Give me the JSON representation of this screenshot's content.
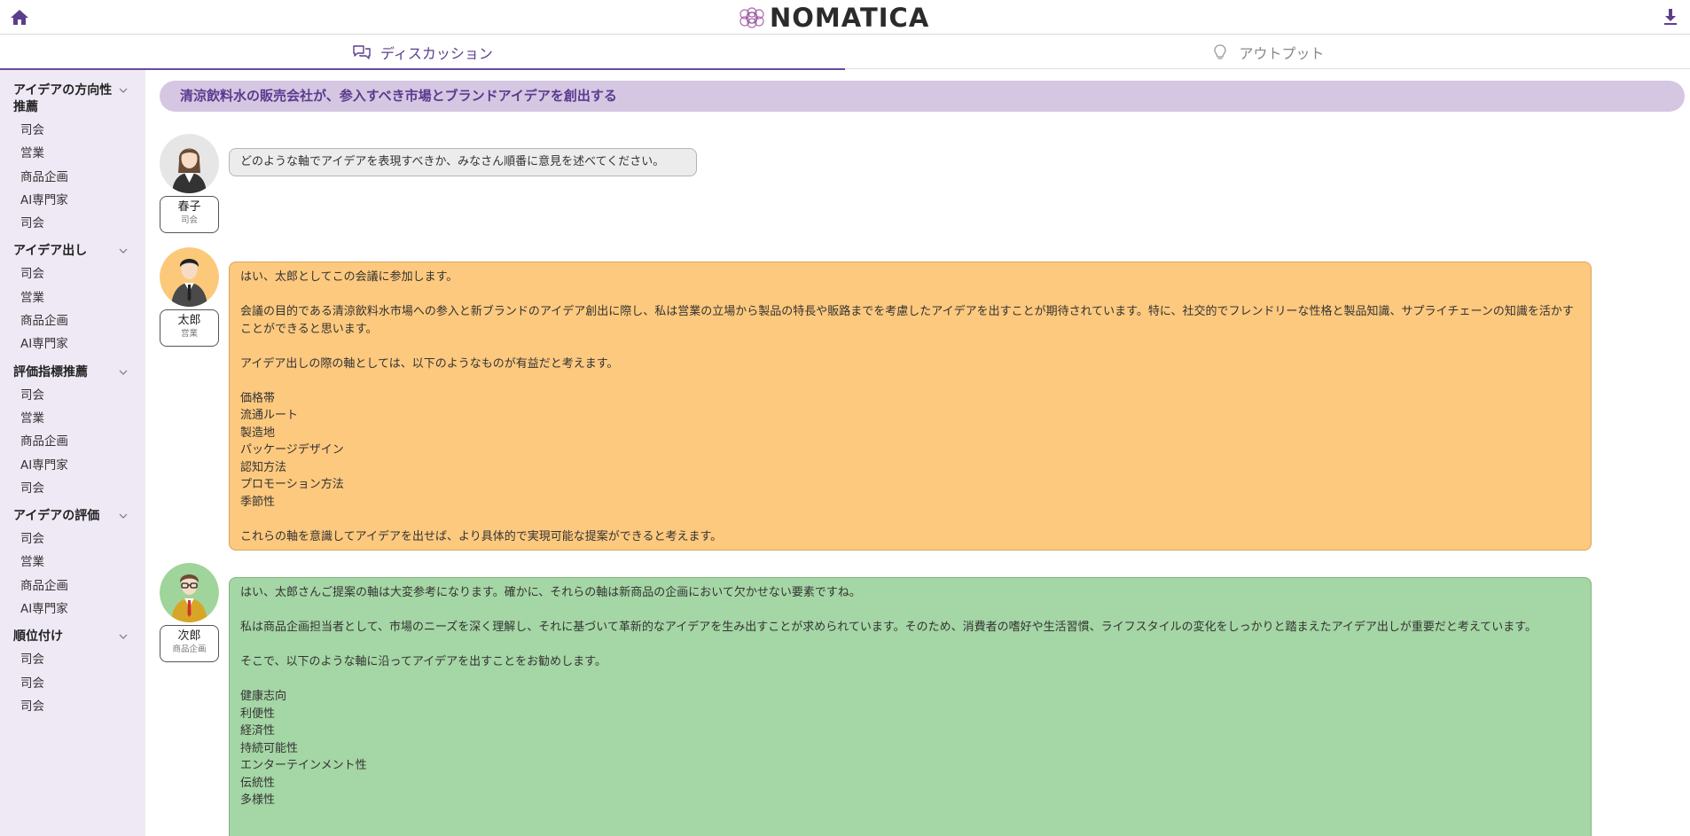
{
  "header": {
    "logo_text": "NOMATICA",
    "home_icon": "home-icon",
    "download_icon": "download-icon"
  },
  "tabs": [
    {
      "label": "ディスカッション",
      "icon": "chat-bubbles-icon",
      "active": true
    },
    {
      "label": "アウトプット",
      "icon": "lightbulb-icon",
      "active": false
    }
  ],
  "sidebar": {
    "sections": [
      {
        "title": "アイデアの方向性推薦",
        "items": [
          "司会",
          "営業",
          "商品企画",
          "AI専門家",
          "司会"
        ]
      },
      {
        "title": "アイデア出し",
        "items": [
          "司会",
          "営業",
          "商品企画",
          "AI専門家"
        ]
      },
      {
        "title": "評価指標推薦",
        "items": [
          "司会",
          "営業",
          "商品企画",
          "AI専門家",
          "司会"
        ]
      },
      {
        "title": "アイデアの評価",
        "items": [
          "司会",
          "営業",
          "商品企画",
          "AI専門家"
        ]
      },
      {
        "title": "順位付け",
        "items": [
          "司会",
          "司会",
          "司会"
        ]
      }
    ]
  },
  "main": {
    "topic": "清涼飲料水の販売会社が、参入すべき市場とブランドアイデアを創出する",
    "messages": [
      {
        "name": "春子",
        "role": "司会",
        "color": "#ececec",
        "text": "どのような軸でアイデアを表現すべきか、みなさん順番に意見を述べてください。"
      },
      {
        "name": "太郎",
        "role": "営業",
        "color": "#fdc97e",
        "text": "はい、太郎としてこの会議に参加します。\n\n会議の目的である清涼飲料水市場への参入と新ブランドのアイデア創出に際し、私は営業の立場から製品の特長や販路までを考慮したアイデアを出すことが期待されています。特に、社交的でフレンドリーな性格と製品知識、サプライチェーンの知識を活かすことができると思います。\n\nアイデア出しの際の軸としては、以下のようなものが有益だと考えます。\n\n価格帯\n流通ルート\n製造地\nパッケージデザイン\n認知方法\nプロモーション方法\n季節性\n\nこれらの軸を意識してアイデアを出せば、より具体的で実現可能な提案ができると考えます。"
      },
      {
        "name": "次郎",
        "role": "商品企画",
        "color": "#a5d6a5",
        "text": "はい、太郎さんご提案の軸は大変参考になります。確かに、それらの軸は新商品の企画において欠かせない要素ですね。\n\n私は商品企画担当者として、市場のニーズを深く理解し、それに基づいて革新的なアイデアを生み出すことが求められています。そのため、消費者の嗜好や生活習慣、ライフスタイルの変化をしっかりと踏まえたアイデア出しが重要だと考えています。\n\nそこで、以下のような軸に沿ってアイデアを出すことをお勧めします。\n\n健康志向\n利便性\n経済性\n持続可能性\nエンターテインメント性\n伝統性\n多様性"
      }
    ]
  }
}
